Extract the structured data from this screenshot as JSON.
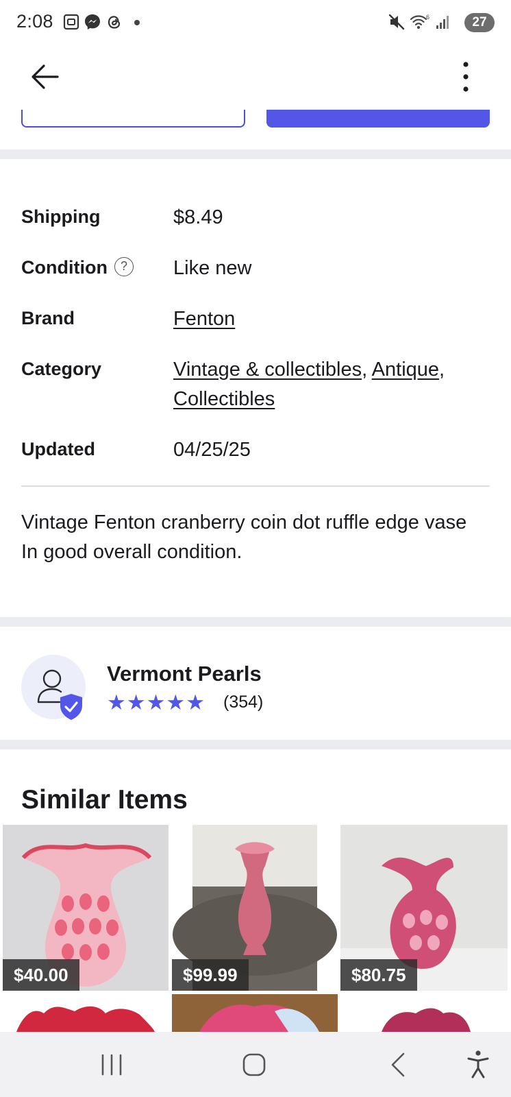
{
  "status_bar": {
    "time": "2:08",
    "battery": "27",
    "icons": [
      "screenshot-icon",
      "messenger-icon",
      "threads-icon",
      "dot-icon",
      "mute-icon",
      "wifi-icon",
      "signal-icon"
    ]
  },
  "app_bar": {
    "back_icon": "arrow-left-icon",
    "more_icon": "more-vertical-icon"
  },
  "details": {
    "shipping_label": "Shipping",
    "shipping_value": "$8.49",
    "condition_label": "Condition",
    "condition_help": "?",
    "condition_value": "Like new",
    "brand_label": "Brand",
    "brand_value": "Fenton",
    "category_label": "Category",
    "category_links": [
      "Vintage & collectibles",
      "Antique",
      "Collectibles"
    ],
    "category_separator": ",",
    "updated_label": "Updated",
    "updated_value": "04/25/25"
  },
  "description": {
    "line1": "Vintage Fenton cranberry coin dot ruffle edge vase",
    "line2": "In good overall condition."
  },
  "seller": {
    "name": "Vermont Pearls",
    "rating_stars": 5,
    "review_count": "(354)",
    "verified_icon": "verified-shield-icon"
  },
  "similar": {
    "title": "Similar Items",
    "items": [
      {
        "price": "$40.00"
      },
      {
        "price": "$99.99"
      },
      {
        "price": "$80.75"
      }
    ]
  },
  "colors": {
    "accent": "#5257e8",
    "section_gap": "#ebecef"
  },
  "nav_bar": {
    "icons": [
      "recent-apps-icon",
      "home-icon",
      "back-icon",
      "accessibility-icon"
    ]
  }
}
